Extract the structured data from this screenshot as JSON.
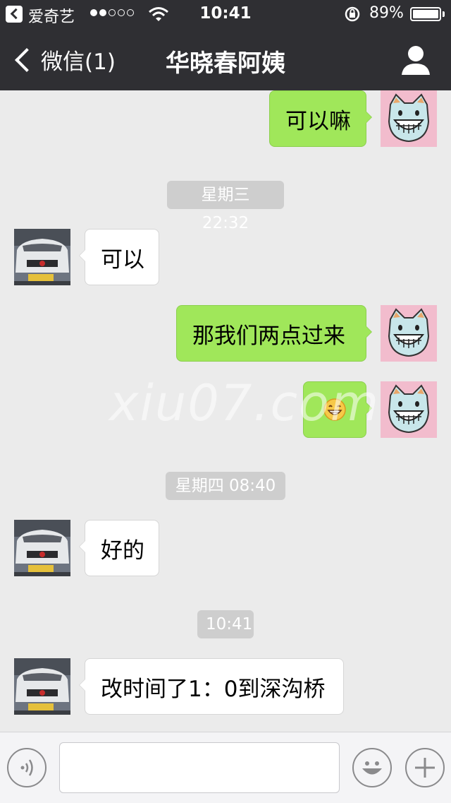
{
  "status_bar": {
    "carrier": "爱奇艺",
    "time": "10:41",
    "battery": "89%",
    "battery_level": 0.89,
    "signal_bars": 2
  },
  "nav": {
    "back_label": "微信(1)",
    "title": "华晓春阿姨"
  },
  "messages": [
    {
      "side": "out",
      "text": "可以嘛",
      "avatar": "cat-avatar"
    },
    {
      "timestamp": "星期三 22:32"
    },
    {
      "side": "in",
      "text": "可以",
      "avatar": "car-avatar"
    },
    {
      "side": "out",
      "text": "那我们两点过来",
      "avatar": "cat-avatar"
    },
    {
      "side": "out",
      "text": "😁",
      "avatar": "cat-avatar"
    },
    {
      "timestamp": "星期四 08:40"
    },
    {
      "side": "in",
      "text": "好的",
      "avatar": "car-avatar"
    },
    {
      "timestamp": "10:41"
    },
    {
      "side": "in",
      "text": "改时间了1：0到深沟桥",
      "avatar": "car-avatar"
    }
  ],
  "watermark": "xiu07.com",
  "input_bar": {
    "voice_icon": "voice-icon",
    "emoji_icon": "emoji-icon",
    "plus_icon": "plus-icon"
  },
  "colors": {
    "bar_bg": "#2f2f33",
    "chat_bg": "#ebebeb",
    "out_bubble": "#a0e75a",
    "in_bubble": "#ffffff",
    "timestamp_bg": "#cecece"
  }
}
